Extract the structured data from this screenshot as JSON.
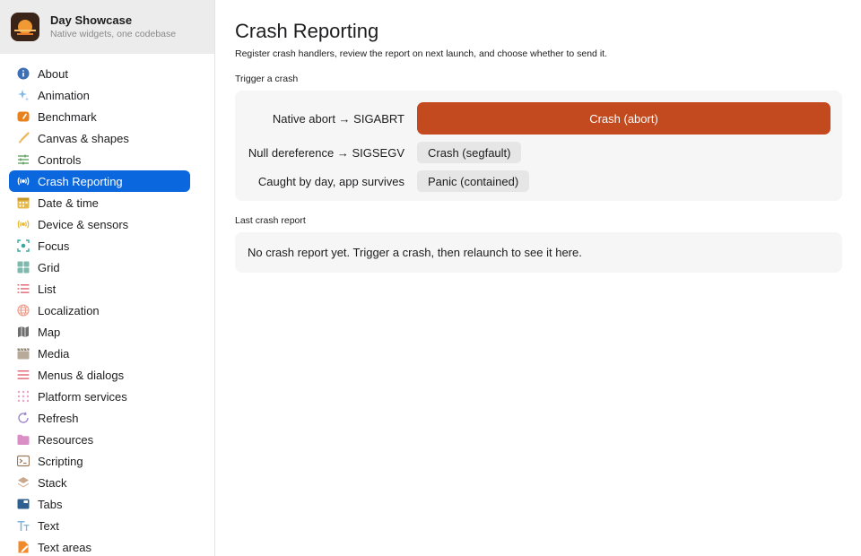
{
  "app": {
    "name": "Day Showcase",
    "subtitle": "Native widgets, one codebase"
  },
  "sidebar": {
    "items": [
      {
        "label": "About",
        "icon": "info-icon",
        "active": false
      },
      {
        "label": "Animation",
        "icon": "sparkles-icon",
        "active": false
      },
      {
        "label": "Benchmark",
        "icon": "gauge-icon",
        "active": false
      },
      {
        "label": "Canvas & shapes",
        "icon": "brush-icon",
        "active": false
      },
      {
        "label": "Controls",
        "icon": "sliders-icon",
        "active": false
      },
      {
        "label": "Crash Reporting",
        "icon": "broadcast-icon",
        "active": true
      },
      {
        "label": "Date & time",
        "icon": "calendar-icon",
        "active": false
      },
      {
        "label": "Device & sensors",
        "icon": "sensor-icon",
        "active": false
      },
      {
        "label": "Focus",
        "icon": "focus-icon",
        "active": false
      },
      {
        "label": "Grid",
        "icon": "grid-icon",
        "active": false
      },
      {
        "label": "List",
        "icon": "list-icon",
        "active": false
      },
      {
        "label": "Localization",
        "icon": "globe-icon",
        "active": false
      },
      {
        "label": "Map",
        "icon": "map-icon",
        "active": false
      },
      {
        "label": "Media",
        "icon": "clapper-icon",
        "active": false
      },
      {
        "label": "Menus & dialogs",
        "icon": "menu-icon",
        "active": false
      },
      {
        "label": "Platform services",
        "icon": "dots-grid-icon",
        "active": false
      },
      {
        "label": "Refresh",
        "icon": "refresh-icon",
        "active": false
      },
      {
        "label": "Resources",
        "icon": "folder-icon",
        "active": false
      },
      {
        "label": "Scripting",
        "icon": "terminal-icon",
        "active": false
      },
      {
        "label": "Stack",
        "icon": "layers-icon",
        "active": false
      },
      {
        "label": "Tabs",
        "icon": "tabs-icon",
        "active": false
      },
      {
        "label": "Text",
        "icon": "text-icon",
        "active": false
      },
      {
        "label": "Text areas",
        "icon": "text-area-icon",
        "active": false
      }
    ]
  },
  "main": {
    "title": "Crash Reporting",
    "description": "Register crash handlers, review the report on next launch, and choose whether to send it.",
    "trigger_section": "Trigger a crash",
    "triggers": [
      {
        "label": "Native abort → SIGABRT",
        "button": "Crash (abort)"
      },
      {
        "label": "Null dereference → SIGSEGV",
        "button": "Crash (segfault)"
      },
      {
        "label": "Caught by day, app survives",
        "button": "Panic (contained)"
      }
    ],
    "report_section": "Last crash report",
    "report_text": "No crash report yet. Trigger a crash, then relaunch to see it here."
  },
  "colors": {
    "accent": "#0a67de",
    "danger": "#c24a1e"
  }
}
